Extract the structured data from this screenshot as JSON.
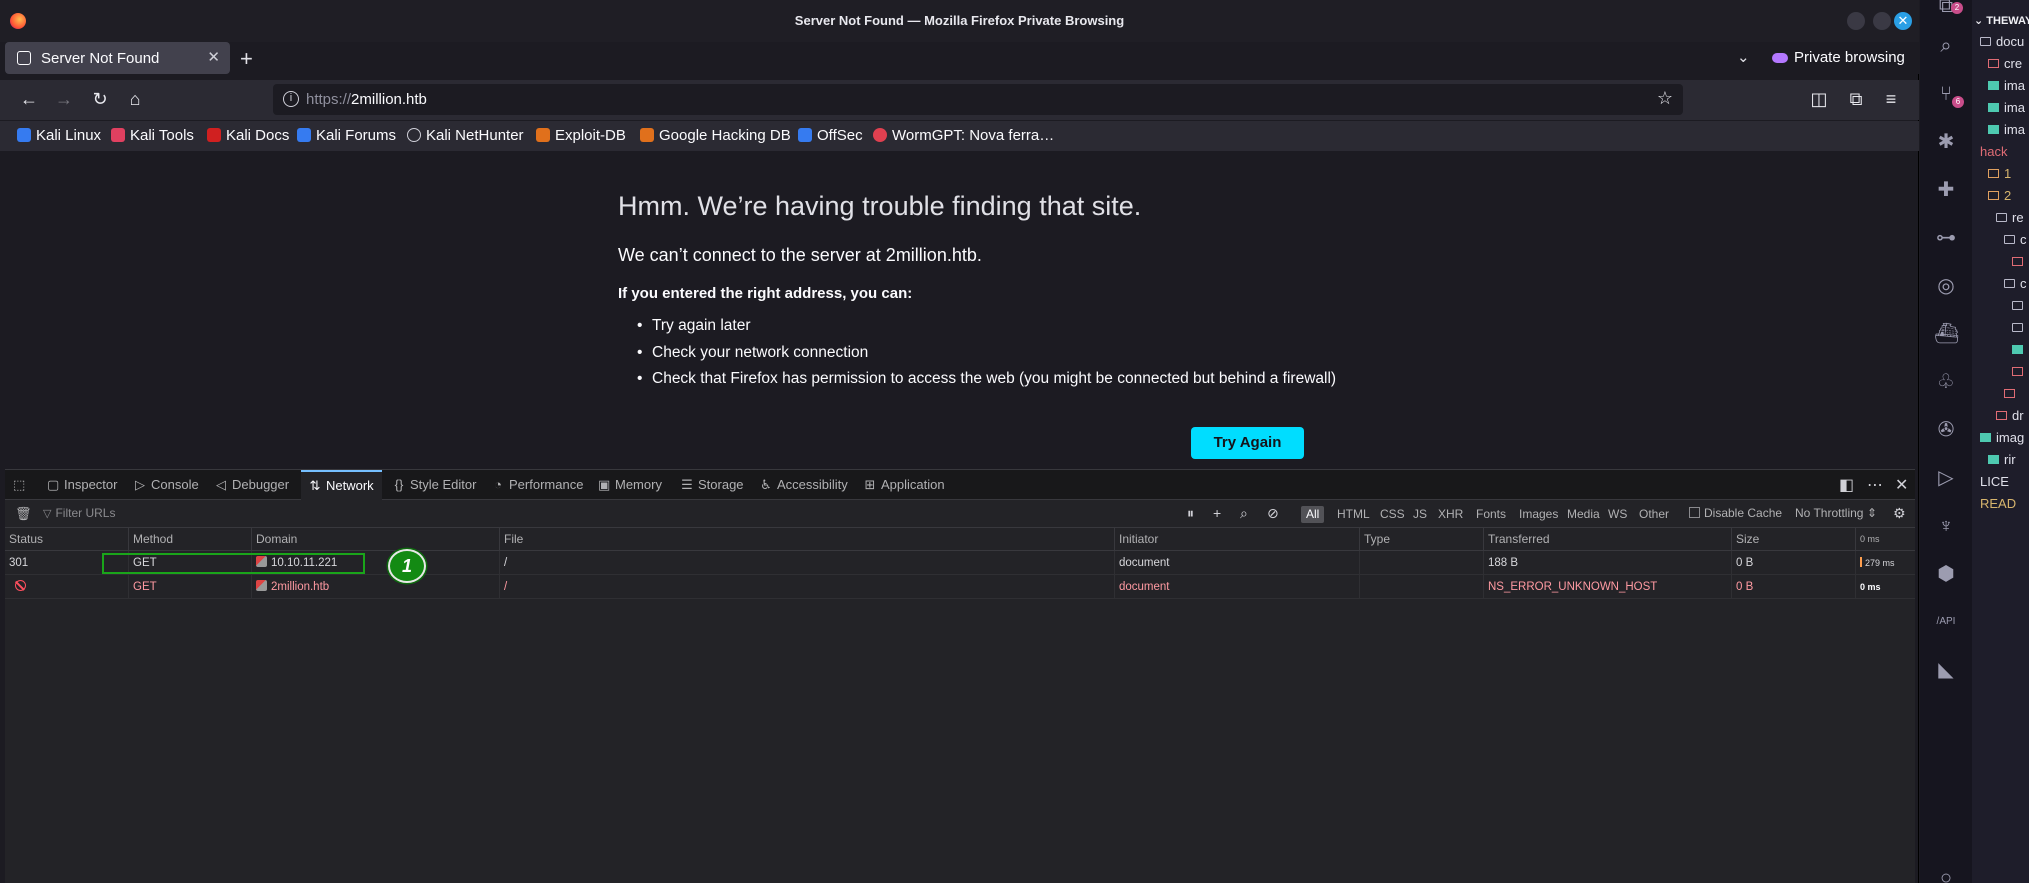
{
  "window": {
    "title": "Server Not Found — Mozilla Firefox Private Browsing"
  },
  "tabs": {
    "active_label": "Server Not Found",
    "private_label": "Private browsing"
  },
  "urlbar": {
    "scheme": "https://",
    "host": "2million.htb"
  },
  "bookmarks": [
    {
      "label": "Kali Linux",
      "color": "#367bf0"
    },
    {
      "label": "Kali Tools",
      "color": "#e04060"
    },
    {
      "label": "Kali Docs",
      "color": "#d02020"
    },
    {
      "label": "Kali Forums",
      "color": "#367bf0"
    },
    {
      "label": "Kali NetHunter",
      "color": "#cfcfd8"
    },
    {
      "label": "Exploit-DB",
      "color": "#e0701c"
    },
    {
      "label": "Google Hacking DB",
      "color": "#e0701c"
    },
    {
      "label": "OffSec",
      "color": "#367bf0"
    },
    {
      "label": "WormGPT: Nova ferra…",
      "color": "#e04050"
    }
  ],
  "error_page": {
    "title": "Hmm. We’re having trouble finding that site.",
    "subtitle": "We can’t connect to the server at 2million.htb.",
    "suggest_heading": "If you entered the right address, you can:",
    "suggestions": [
      "Try again later",
      "Check your network connection",
      "Check that Firefox has permission to access the web (you might be connected but behind a firewall)"
    ],
    "try_again": "Try Again",
    "accent": "#00ddff"
  },
  "devtools": {
    "tabs": [
      "Inspector",
      "Console",
      "Debugger",
      "Network",
      "Style Editor",
      "Performance",
      "Memory",
      "Storage",
      "Accessibility",
      "Application"
    ],
    "active_tab": "Network",
    "filter_placeholder": "Filter URLs",
    "type_filters": [
      "All",
      "HTML",
      "CSS",
      "JS",
      "XHR",
      "Fonts",
      "Images",
      "Media",
      "WS",
      "Other"
    ],
    "disable_cache": "Disable Cache",
    "throttling": "No Throttling ⇕",
    "columns": [
      "Status",
      "Method",
      "Domain",
      "File",
      "Initiator",
      "Type",
      "Transferred",
      "Size",
      "0 ms"
    ],
    "rows": [
      {
        "status": "301",
        "method": "GET",
        "domain": "10.10.11.221",
        "file": "/",
        "initiator": "document",
        "type": "",
        "transferred": "188 B",
        "size": "0 B",
        "timing": "279 ms"
      },
      {
        "status": "",
        "method": "GET",
        "domain": "2million.htb",
        "file": "/",
        "initiator": "document",
        "type": "",
        "transferred": "NS_ERROR_UNKNOWN_HOST",
        "size": "0 B",
        "timing": "0 ms"
      }
    ],
    "annotation_label": "1"
  },
  "vscode": {
    "explorer_header": "THEWAYS",
    "items": [
      {
        "label": "docu",
        "icon": "folder",
        "indent": 8
      },
      {
        "label": "cre",
        "icon": "red",
        "indent": 16
      },
      {
        "label": "ima",
        "icon": "img",
        "indent": 16
      },
      {
        "label": "ima",
        "icon": "img",
        "indent": 16
      },
      {
        "label": "ima",
        "icon": "img",
        "indent": 16
      },
      {
        "label": "hack",
        "icon": "",
        "indent": 8,
        "tone": "pink"
      },
      {
        "label": "1",
        "icon": "org",
        "indent": 16,
        "tone": "gold"
      },
      {
        "label": "2",
        "icon": "org",
        "indent": 16,
        "tone": "gold"
      },
      {
        "label": "re",
        "icon": "folder",
        "indent": 24
      },
      {
        "label": "c",
        "icon": "folder",
        "indent": 32
      },
      {
        "label": "",
        "icon": "red",
        "indent": 40
      },
      {
        "label": "c",
        "icon": "folder",
        "indent": 32
      },
      {
        "label": "",
        "icon": "folder",
        "indent": 40
      },
      {
        "label": "",
        "icon": "folder",
        "indent": 40
      },
      {
        "label": "",
        "icon": "img",
        "indent": 40
      },
      {
        "label": "",
        "icon": "red",
        "indent": 40
      },
      {
        "label": "",
        "icon": "red",
        "indent": 32
      },
      {
        "label": "dr",
        "icon": "red",
        "indent": 24
      },
      {
        "label": "imag",
        "icon": "img",
        "indent": 8
      },
      {
        "label": "rir",
        "icon": "img",
        "indent": 16
      },
      {
        "label": "LICE",
        "icon": "",
        "indent": 8
      },
      {
        "label": "READ",
        "icon": "",
        "indent": 8,
        "tone": "gold"
      }
    ],
    "badges": {
      "scm": "6",
      "account": "2"
    }
  }
}
